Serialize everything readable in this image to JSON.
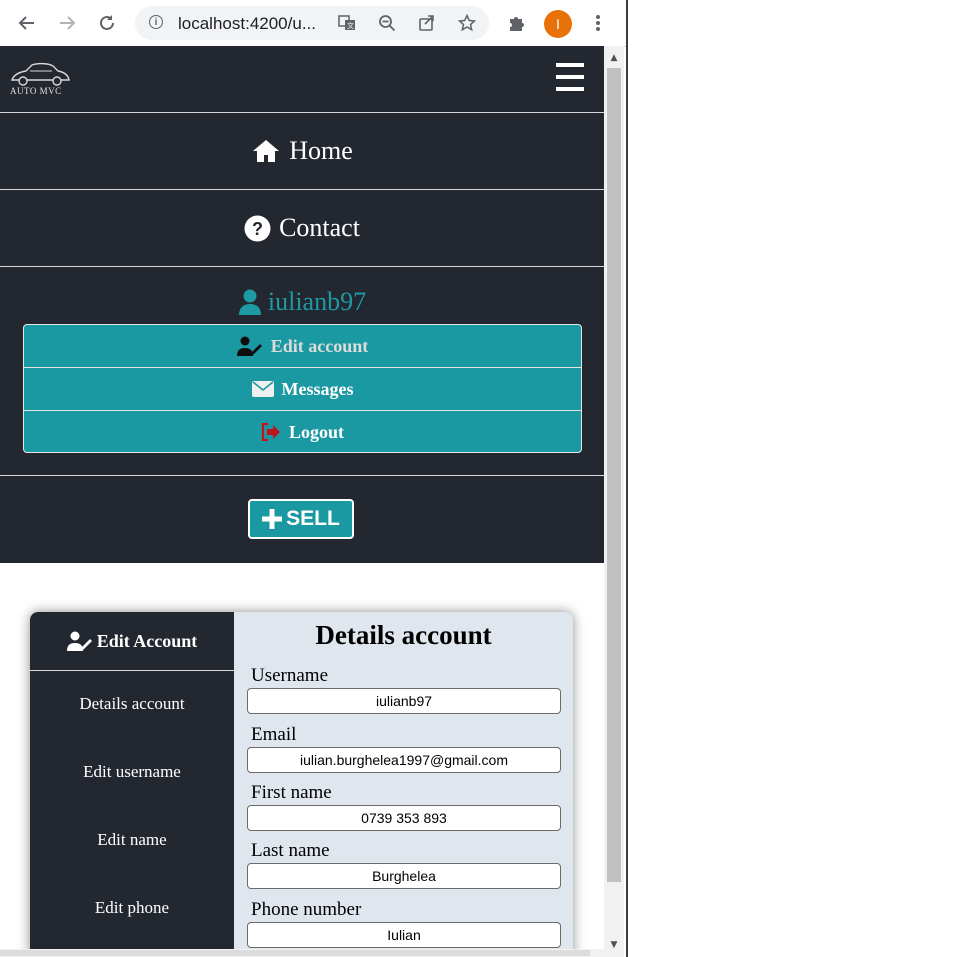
{
  "browser": {
    "url": "localhost:4200/u...",
    "profile_initial": "I",
    "back_icon": "arrow-left-icon",
    "forward_icon": "arrow-right-icon",
    "reload_icon": "reload-icon"
  },
  "navbar": {
    "logo_text": "AUTO MVC",
    "items": [
      {
        "label": "Home",
        "icon": "home-icon"
      },
      {
        "label": "Contact",
        "icon": "question-circle-icon"
      }
    ],
    "user": {
      "username": "iulianb97",
      "menu": [
        {
          "label": "Edit account",
          "icon": "user-edit-icon"
        },
        {
          "label": "Messages",
          "icon": "envelope-icon"
        },
        {
          "label": "Logout",
          "icon": "sign-out-icon"
        }
      ]
    },
    "sell_label": "SELL"
  },
  "account": {
    "sidebar_title": "Edit Account",
    "sidebar_items": [
      "Details account",
      "Edit username",
      "Edit name",
      "Edit phone"
    ],
    "title": "Details account",
    "fields": [
      {
        "label": "Username",
        "value": "iulianb97"
      },
      {
        "label": "Email",
        "value": "iulian.burghelea1997@gmail.com"
      },
      {
        "label": "First name",
        "value": "0739 353 893"
      },
      {
        "label": "Last name",
        "value": "Burghelea"
      },
      {
        "label": "Phone number",
        "value": "Iulian"
      }
    ]
  },
  "colors": {
    "navbar_bg": "#23272f",
    "accent_teal": "#1b99a2",
    "card_bg": "#e0e6ee",
    "logout_icon": "#c0141b"
  }
}
